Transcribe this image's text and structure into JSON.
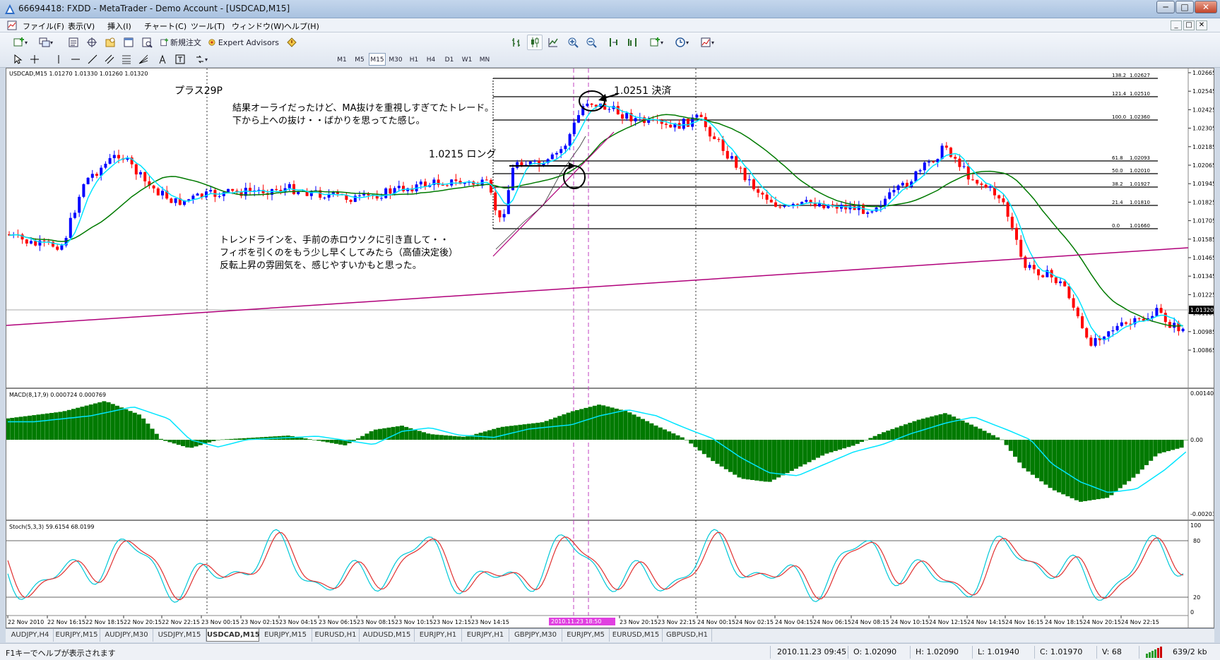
{
  "window": {
    "title": "66694418: FXDD - MetaTrader - Demo Account - [USDCAD,M15]",
    "minimize": "─",
    "maximize": "□",
    "close": "✕",
    "mdi_buttons": [
      "_",
      "□",
      "✕"
    ]
  },
  "menu": [
    "ファイル(F)",
    "表示(V)",
    "挿入(I)",
    "チャート(C)",
    "ツール(T)",
    "ウィンドウ(W)",
    "ヘルプ(H)"
  ],
  "toolbar": {
    "new_order_label": "新規注文",
    "expert_advisors_label": "Expert Advisors",
    "timeframes": [
      "M1",
      "M5",
      "M15",
      "M30",
      "H1",
      "H4",
      "D1",
      "W1",
      "MN"
    ],
    "active_timeframe": "M15"
  },
  "chart": {
    "info_line": "USDCAD,M15  1.01270 1.01330 1.01260 1.01320",
    "current_price": "1.01320",
    "price_axis": [
      "1.02665",
      "1.02545",
      "1.02425",
      "1.02305",
      "1.02185",
      "1.02065",
      "1.01945",
      "1.01825",
      "1.01705",
      "1.01585",
      "1.01465",
      "1.01345",
      "1.01225",
      "1.01105",
      "1.00985",
      "1.00865"
    ],
    "fib_levels": [
      {
        "level": "138.2",
        "price": "1.02627"
      },
      {
        "level": "121.4",
        "price": "1.02510"
      },
      {
        "level": "100.0",
        "price": "1.02360"
      },
      {
        "level": "61.8",
        "price": "1.02093"
      },
      {
        "level": "50.0",
        "price": "1.02010"
      },
      {
        "level": "38.2",
        "price": "1.01927"
      },
      {
        "level": "21.4",
        "price": "1.01810"
      },
      {
        "level": "0.0",
        "price": "1.01660"
      }
    ],
    "annotations": {
      "plus": "プラス29P",
      "comment1_line1": "結果オーライだったけど、MA抜けを重視しすぎてたトレード。",
      "comment1_line2": "下から上への抜け・・ばかりを思ってた感じ。",
      "entry": "1.0215 ロング",
      "exit": "1.0251  決済",
      "comment2_line1": "トレンドラインを、手前の赤ロウソクに引き直して・・",
      "comment2_line2": "フィボを引くのをもう少し早くしてみたら（高値決定後）",
      "comment2_line3": "反転上昇の雰囲気を、感じやすいかもと思った。"
    },
    "macd_label": "MACD(8,17,9) 0.000724 0.000769",
    "macd_axis": [
      "0.001404",
      "0.00",
      "-0.00203"
    ],
    "stoch_label": "Stoch(5,3,3) 59.6154 68.0199",
    "stoch_axis": [
      "100",
      "80",
      "20",
      "0"
    ],
    "time_axis": [
      "22 Nov 2010",
      "22 Nov 16:15",
      "22 Nov 18:15",
      "22 Nov 20:15",
      "22 Nov 22:15",
      "23 Nov 00:15",
      "23 Nov 02:15",
      "23 Nov 04:15",
      "23 Nov 06:15",
      "23 Nov 08:15",
      "23 Nov 10:15",
      "23 Nov 12:15",
      "23 Nov 14:15",
      "23 Nov 20:15",
      "23 Nov 22:15",
      "24 Nov 00:15",
      "24 Nov 02:15",
      "24 Nov 04:15",
      "24 Nov 06:15",
      "24 Nov 08:15",
      "24 Nov 10:15",
      "24 Nov 12:15",
      "24 Nov 14:15",
      "24 Nov 16:15",
      "24 Nov 18:15",
      "24 Nov 20:15",
      "24 Nov 22:15"
    ],
    "time_highlight": "2010.11.23 18:50",
    "colors": {
      "up": "#0000ff",
      "down": "#ff0000",
      "ma_fast": "#00e5ff",
      "ma_slow": "#007a00",
      "trendline": "#b0007a",
      "macd_hist": "#007a00",
      "macd_signal": "#00e5ff"
    }
  },
  "tabs": [
    "AUDJPY,H4",
    "EURJPY,M15",
    "AUDJPY,M30",
    "USDJPY,M15",
    "USDCAD,M15",
    "EURJPY,M15",
    "EURUSD,H1",
    "AUDUSD,M15",
    "EURJPY,H1",
    "EURJPY,H1",
    "GBPJPY,M30",
    "EURJPY,M5",
    "EURUSD,M15",
    "GBPUSD,H1"
  ],
  "active_tab": "USDCAD,M15",
  "status": {
    "help": "F1キーでヘルプが表示されます",
    "datetime": "2010.11.23 09:45",
    "open": "O: 1.02090",
    "high": "H: 1.02090",
    "low": "L: 1.01940",
    "close": "C: 1.01970",
    "volume": "V: 68",
    "traffic": "639/2 kb"
  }
}
